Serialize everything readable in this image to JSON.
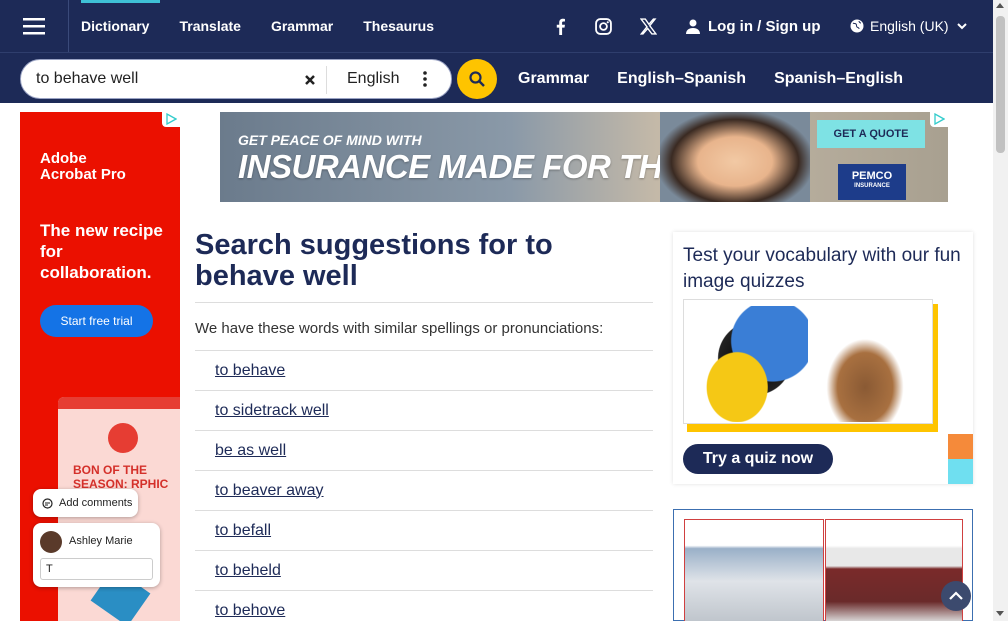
{
  "nav": {
    "links": [
      "Dictionary",
      "Translate",
      "Grammar",
      "Thesaurus"
    ],
    "active_index": 0,
    "social_icons": [
      "facebook-icon",
      "instagram-icon",
      "x-icon"
    ],
    "login_label": "Log in / Sign up",
    "language_label": "English (UK)"
  },
  "search": {
    "value": "to behave well",
    "language": "English",
    "links": [
      "Grammar",
      "English–Spanish",
      "Spanish–English"
    ]
  },
  "left_ad": {
    "brand": "Adobe\nAcrobat Pro",
    "headline": "The new recipe for collaboration.",
    "cta": "Start free trial",
    "card_text": "BON OF THE SEASON: RPHIC",
    "comment_pill": "Add comments",
    "commenter_name": "Ashley Marie",
    "comment_input_value": "T"
  },
  "top_ad": {
    "small": "GET PEACE OF MIND WITH",
    "big": "INSURANCE MADE FOR THE PNW",
    "cta": "GET A QUOTE",
    "logo": "PEMCO",
    "logo_sub": "INSURANCE"
  },
  "main": {
    "heading_prefix": "Search suggestions for ",
    "heading_term": "to behave well",
    "intro": "We have these words with similar spellings or pronunciations:",
    "suggestions": [
      "to behave",
      "to sidetrack well",
      "be as well",
      "to beaver away",
      "to befall",
      "to beheld",
      "to behove"
    ]
  },
  "quiz": {
    "title": "Test your vocabulary with our fun image quizzes",
    "button": "Try a quiz now"
  },
  "colors": {
    "navy": "#1d2a57",
    "accent_yellow": "#fec400",
    "active_tab_underline": "#3fc1d6",
    "adobe_red": "#eb1000"
  }
}
